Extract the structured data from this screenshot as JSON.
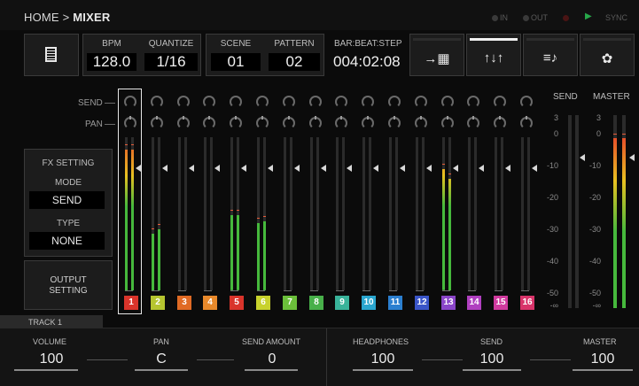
{
  "breadcrumb": {
    "home": "HOME",
    "separator": ">",
    "current": "MIXER"
  },
  "status": {
    "in": "IN",
    "out": "OUT",
    "sync": "SYNC"
  },
  "header": {
    "file_icon": "document-icon",
    "bpm_label": "BPM",
    "bpm_value": "128.0",
    "quantize_label": "QUANTIZE",
    "quantize_value": "1/16",
    "scene_label": "SCENE",
    "scene_value": "01",
    "pattern_label": "PATTERN",
    "pattern_value": "02",
    "bbs_label": "BAR:BEAT:STEP",
    "bbs_value": "004:02:08"
  },
  "toolbar": [
    {
      "name": "sequencer-icon",
      "glyph": "→▦",
      "active": false
    },
    {
      "name": "mixer-icon",
      "glyph": "↑↓↑",
      "active": true
    },
    {
      "name": "notes-icon",
      "glyph": "≡♪",
      "active": false
    },
    {
      "name": "settings-gear-icon",
      "glyph": "✿",
      "active": false
    }
  ],
  "mixer": {
    "send_label": "SEND",
    "pan_label": "PAN",
    "selected_track": 1,
    "tracks": [
      {
        "num": "1",
        "color": "#d9342b",
        "meter": [
          0.92,
          0.92
        ]
      },
      {
        "num": "2",
        "color": "#b6c530",
        "meter": [
          0.37,
          0.4
        ]
      },
      {
        "num": "3",
        "color": "#e06a24",
        "meter": [
          0,
          0
        ]
      },
      {
        "num": "4",
        "color": "#e8892b",
        "meter": [
          0,
          0
        ]
      },
      {
        "num": "5",
        "color": "#d9342b",
        "meter": [
          0.49,
          0.49
        ]
      },
      {
        "num": "6",
        "color": "#c8d22d",
        "meter": [
          0.44,
          0.45
        ]
      },
      {
        "num": "7",
        "color": "#6bbf3a",
        "meter": [
          0,
          0
        ]
      },
      {
        "num": "8",
        "color": "#48b04a",
        "meter": [
          0,
          0
        ]
      },
      {
        "num": "9",
        "color": "#39b39a",
        "meter": [
          0,
          0
        ]
      },
      {
        "num": "10",
        "color": "#2aa6cf",
        "meter": [
          0,
          0
        ]
      },
      {
        "num": "11",
        "color": "#2b7fd0",
        "meter": [
          0,
          0
        ]
      },
      {
        "num": "12",
        "color": "#3a55c8",
        "meter": [
          0,
          0
        ]
      },
      {
        "num": "13",
        "color": "#8a45c8",
        "meter": [
          0.79,
          0.73
        ]
      },
      {
        "num": "14",
        "color": "#b040c0",
        "meter": [
          0,
          0
        ]
      },
      {
        "num": "15",
        "color": "#d03a9e",
        "meter": [
          0,
          0
        ]
      },
      {
        "num": "16",
        "color": "#d8346a",
        "meter": [
          0,
          0
        ]
      }
    ]
  },
  "fx": {
    "title": "FX SETTING",
    "mode_label": "MODE",
    "mode_value": "SEND",
    "type_label": "TYPE",
    "type_value": "NONE"
  },
  "output_button": {
    "line1": "OUTPUT",
    "line2": "SETTING"
  },
  "right_meters": {
    "send_label": "SEND",
    "master_label": "MASTER",
    "scale": [
      "3",
      "0",
      "-10",
      "-20",
      "-30",
      "-40",
      "-50",
      "-∞"
    ],
    "master_level": [
      0.88,
      0.88
    ]
  },
  "track_tab": "TRACK 1",
  "bottom": {
    "volume_label": "VOLUME",
    "volume_value": "100",
    "pan_label": "PAN",
    "pan_value": "C",
    "send_amount_label": "SEND AMOUNT",
    "send_amount_value": "0",
    "headphones_label": "HEADPHONES",
    "headphones_value": "100",
    "send_label": "SEND",
    "send_value": "100",
    "master_label": "MASTER",
    "master_value": "100"
  },
  "colors": {
    "meter_gradient_low": "#46b93c",
    "meter_gradient_mid": "#e8c020",
    "meter_gradient_high": "#e8502a"
  }
}
